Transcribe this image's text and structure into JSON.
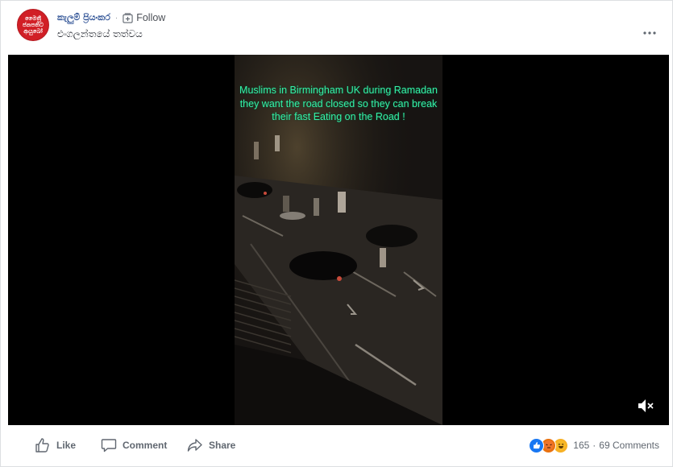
{
  "post": {
    "avatar_text": "මෛත්‍රී\nජනපතිට\nආයුබෝ",
    "author": "කැලුම් ප්‍රියංකර",
    "separator": "·",
    "follow_label": "Follow",
    "text": "එංගලන්තයේ තත්වය"
  },
  "video": {
    "caption": "Muslims in Birmingham UK during Ramadan they want the road closed so they can break their fast Eating on the Road !",
    "caption_color": "#35f0a7"
  },
  "actions": {
    "like": "Like",
    "comment": "Comment",
    "share": "Share"
  },
  "reactions": {
    "icons": [
      "like-icon",
      "angry-icon",
      "haha-icon"
    ],
    "count": "165",
    "separator": "·",
    "comments": "69 Comments"
  }
}
